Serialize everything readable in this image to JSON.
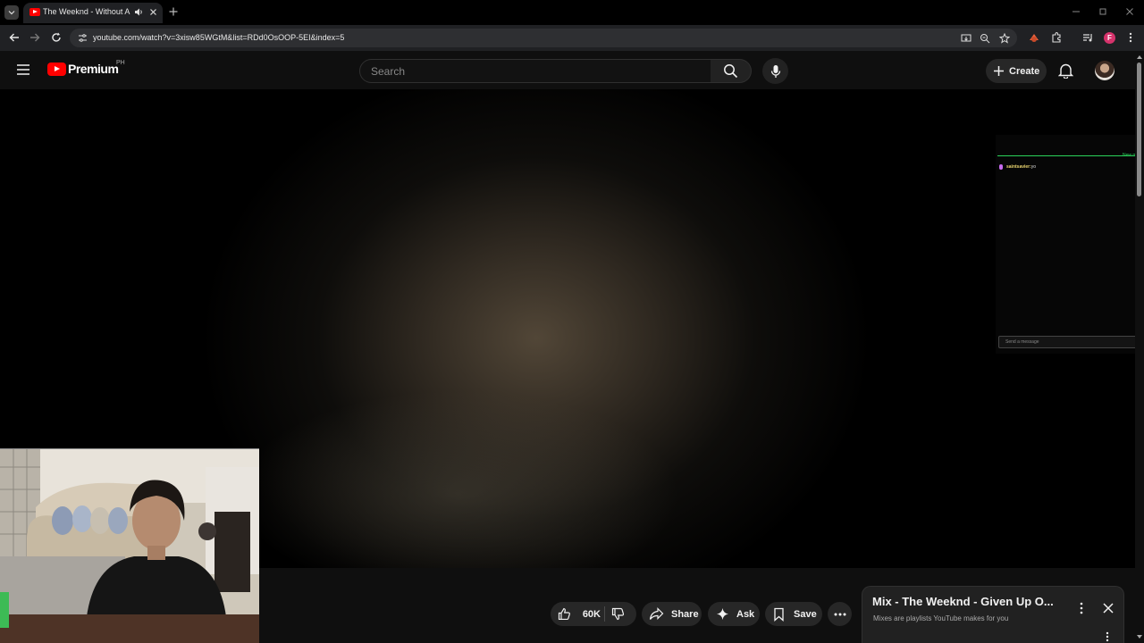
{
  "browser": {
    "tab": {
      "title": "The Weeknd - Without A W",
      "audio_icon": "speaker-icon",
      "close_icon": "close-icon"
    },
    "address_bar": {
      "url": "youtube.com/watch?v=3xisw85WGtM&list=RDd0OsOOP-5EI&index=5"
    },
    "profile_initial": "F",
    "accent": "#d6336c"
  },
  "masthead": {
    "logo_text": "Premium",
    "country_code": "PH",
    "search": {
      "placeholder": "Search"
    },
    "create_label": "Create"
  },
  "chat": {
    "new_label": "New m",
    "messages": [
      {
        "user": "saintsavier:",
        "text": "yo"
      }
    ],
    "input_placeholder": "Send a message",
    "divider_color": "#2bd35b"
  },
  "actions": {
    "like_count": "60K",
    "share_label": "Share",
    "ask_label": "Ask",
    "save_label": "Save"
  },
  "mix": {
    "title": "Mix - The Weeknd - Given Up O...",
    "subtitle": "Mixes are playlists YouTube makes for you"
  },
  "colors": {
    "brand_red": "#ff0000",
    "background": "#0f0f0f"
  }
}
